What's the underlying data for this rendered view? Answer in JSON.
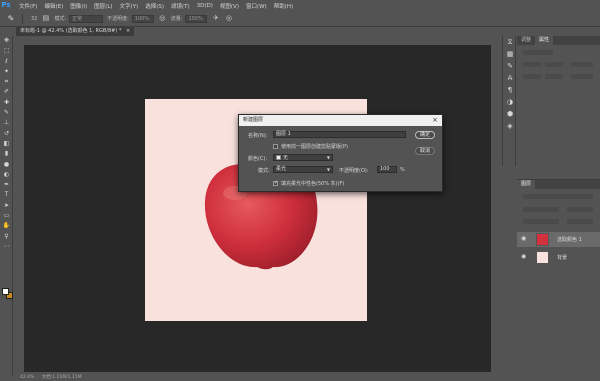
{
  "app": {
    "logo": "Ps",
    "menu": [
      "文件(F)",
      "编辑(E)",
      "图像(I)",
      "图层(L)",
      "文字(Y)",
      "选择(S)",
      "滤镜(T)",
      "3D(D)",
      "视图(V)",
      "窗口(W)",
      "帮助(H)"
    ]
  },
  "options_bar": {
    "tool_icon": "brush-icon",
    "size_value": "32",
    "mode_label": "模式:",
    "mode_value": "正常",
    "opacity_label": "不透明度:",
    "opacity_value": "100%",
    "flow_label": "流量:",
    "flow_value": "100%"
  },
  "document_tab": {
    "label": "未标题-1 @ 42.4% (选取颜色 1, RGB/8#) *",
    "close": "×"
  },
  "status_bar": {
    "zoom": "42.4%",
    "info": "文档:1.11M/1.11M"
  },
  "dialog": {
    "title": "新建图层",
    "close": "×",
    "name_label": "名称(N):",
    "name_value": "图层 1",
    "clip_label": "使用前一图层创建剪贴蒙版(P)",
    "clip_checked": false,
    "color_label": "颜色(C):",
    "color_value": "无",
    "mode_label": "模式:",
    "mode_value": "柔光",
    "opacity_label": "不透明度(O):",
    "opacity_value": "100",
    "opacity_unit": "%",
    "fill_label": "填充柔光中性色(50% 灰)(F)",
    "fill_checked": true,
    "ok_label": "确定",
    "cancel_label": "取消"
  },
  "properties_panel": {
    "tabs": [
      "调整",
      "属性"
    ],
    "active_tab": 1
  },
  "layers_panel": {
    "tabs": [
      "图层"
    ],
    "layers": [
      {
        "name": "选取颜色 1",
        "visible": true,
        "selected": true
      },
      {
        "name": "背景",
        "visible": true,
        "selected": false
      }
    ]
  },
  "colors": {
    "canvas_bg": "#282828",
    "doc_bg": "#f9e2de",
    "apple_red": "#d3313d",
    "ui_gray": "#535353",
    "background_swatch": "#c88a1e"
  }
}
